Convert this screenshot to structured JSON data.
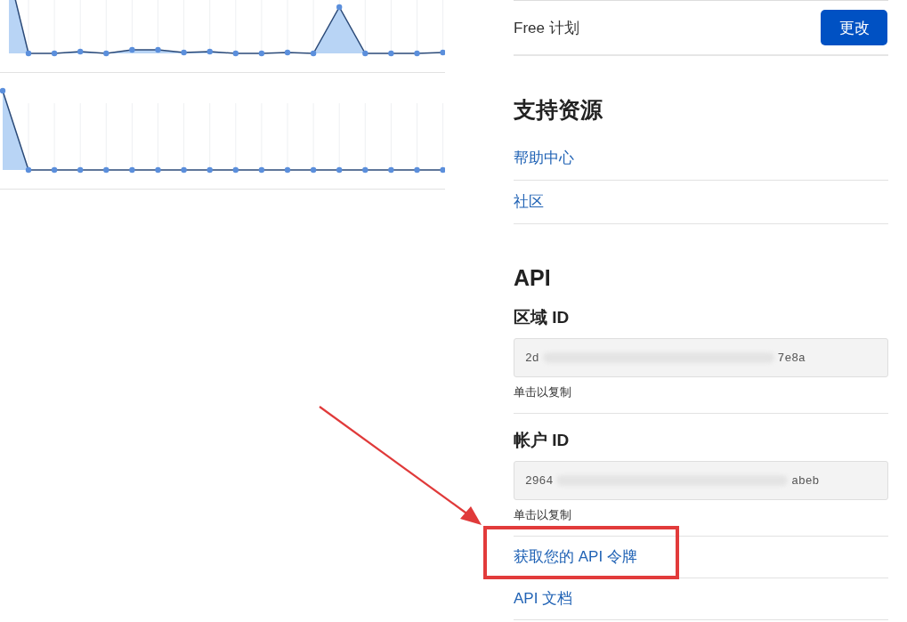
{
  "plan": {
    "name": "Free 计划",
    "button": "更改"
  },
  "support": {
    "heading": "支持资源",
    "links": [
      {
        "label": "帮助中心"
      },
      {
        "label": "社区"
      }
    ]
  },
  "api": {
    "heading": "API",
    "ids": [
      {
        "label": "区域 ID",
        "value_start": "2d",
        "value_end": "7e8a",
        "hint": "单击以复制"
      },
      {
        "label": "帐户 ID",
        "value_start": "2964",
        "value_end": "abeb",
        "hint": "单击以复制"
      }
    ],
    "links": [
      {
        "label": "获取您的 API 令牌",
        "highlighted": true
      },
      {
        "label": "API 文档",
        "highlighted": false
      }
    ]
  }
}
